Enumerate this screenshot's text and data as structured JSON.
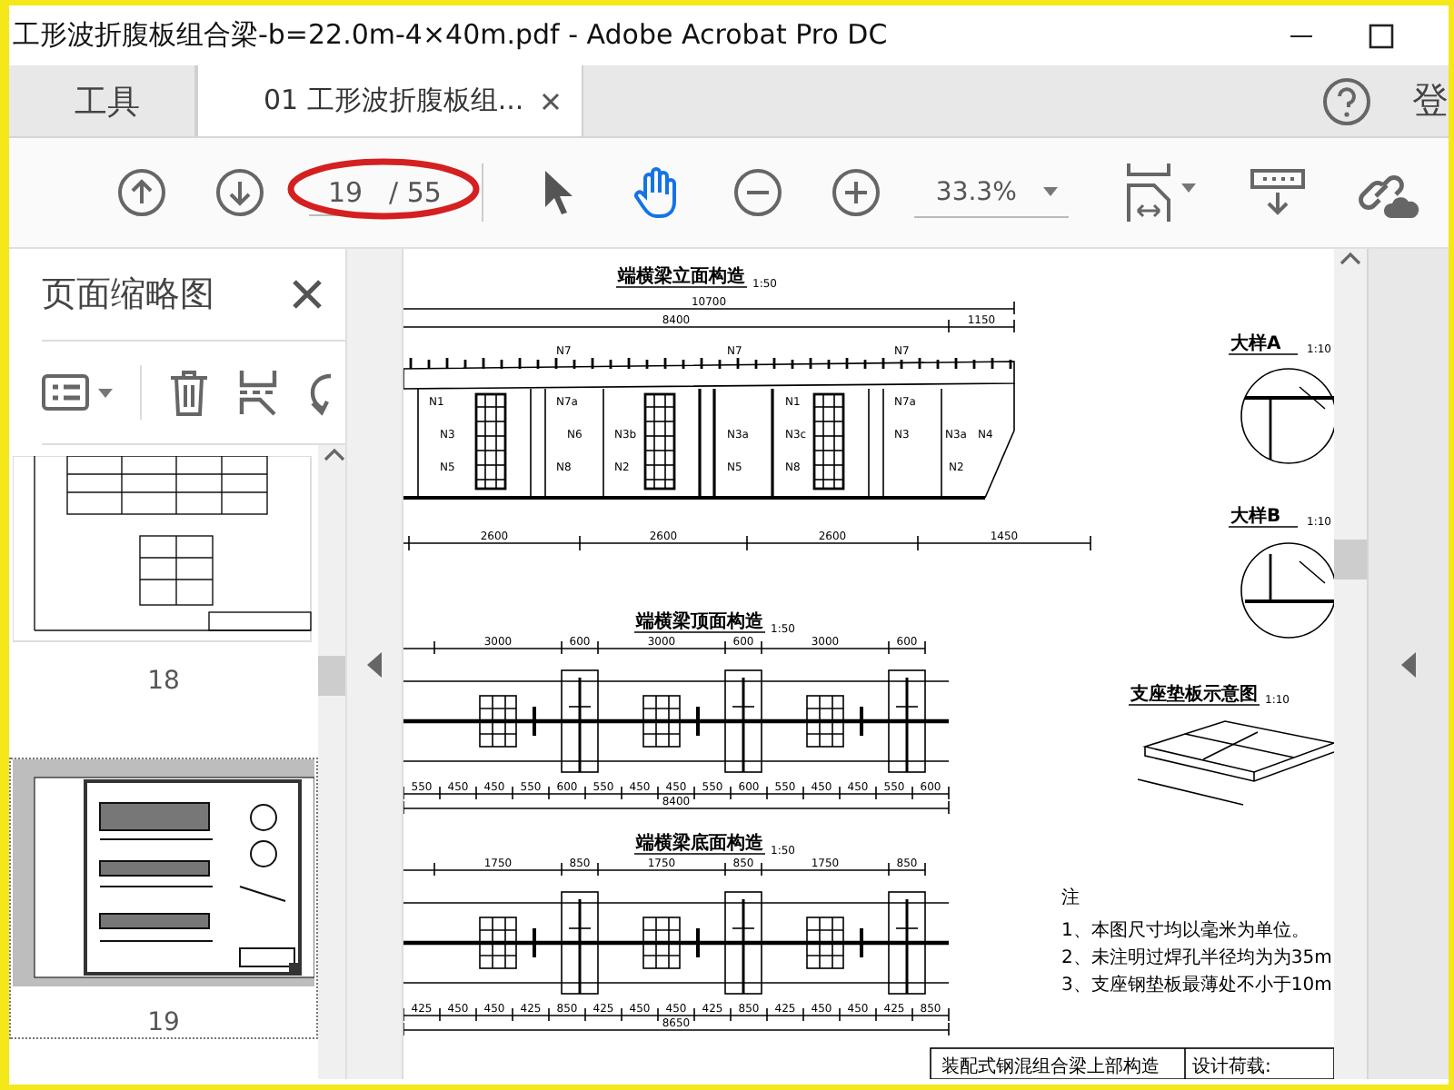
{
  "window": {
    "title": "工形波折腹板组合梁-b=22.0m-4×40m.pdf - Adobe Acrobat Pro DC"
  },
  "tabs": [
    {
      "label": "工具",
      "selected": false,
      "closable": false
    },
    {
      "label": "01 工形波折腹板组...",
      "selected": true,
      "closable": true
    }
  ],
  "sign_in": "登",
  "toolbar": {
    "page_current": "19",
    "page_total": "/ 55",
    "zoom": "33.3%",
    "annotated": true,
    "tools": [
      {
        "kind": "select",
        "selected": false
      },
      {
        "kind": "hand",
        "selected": true
      }
    ]
  },
  "sidebar": {
    "title": "页面缩略图",
    "thumbnails": [
      {
        "page": "18",
        "selected": false
      },
      {
        "page": "19",
        "selected": true
      }
    ]
  },
  "document": {
    "elevation": {
      "title": "端横梁立面构造",
      "scale": "1:50",
      "overall_dims": [
        "10700",
        "8400",
        "1150"
      ],
      "bottom_dims": [
        "2600",
        "2600",
        "2600",
        "1450"
      ],
      "member_labels": [
        "N7",
        "N7",
        "N7",
        "N1",
        "N7a",
        "N1",
        "N7a",
        "N3",
        "N6",
        "N3b",
        "N3a",
        "N3c",
        "N3",
        "N3a",
        "N4",
        "N5",
        "N8",
        "N2",
        "N5",
        "N8",
        "N2"
      ]
    },
    "top_plan": {
      "title": "端横梁顶面构造",
      "scale": "1:50",
      "top_dims": [
        "3000",
        "600",
        "3000",
        "600",
        "3000",
        "600"
      ],
      "bottom_dims": [
        "550",
        "450",
        "450",
        "550",
        "600",
        "550",
        "450",
        "450",
        "550",
        "600",
        "550",
        "450",
        "450",
        "550",
        "600"
      ],
      "total": "8400"
    },
    "bottom_plan": {
      "title": "端横梁底面构造",
      "scale": "1:50",
      "top_dims": [
        "1750",
        "850",
        "1750",
        "850",
        "1750",
        "850"
      ],
      "bottom_dims": [
        "425",
        "450",
        "450",
        "425",
        "850",
        "425",
        "450",
        "450",
        "425",
        "850",
        "425",
        "450",
        "450",
        "425",
        "850"
      ],
      "total": "8650"
    },
    "details": [
      {
        "title": "大样A",
        "scale": "1:10"
      },
      {
        "title": "大样B",
        "scale": "1:10"
      }
    ],
    "bearing_plate": {
      "title": "支座垫板示意图",
      "scale": "1:10"
    },
    "notes": {
      "heading": "注",
      "items": [
        "1、本图尺寸均以毫米为单位。",
        "2、未注明过焊孔半径均为为35m",
        "3、支座钢垫板最薄处不小于10m"
      ]
    },
    "title_block": {
      "title": "装配式钢混组合梁上部构造",
      "cell": "设计荷载:"
    }
  }
}
